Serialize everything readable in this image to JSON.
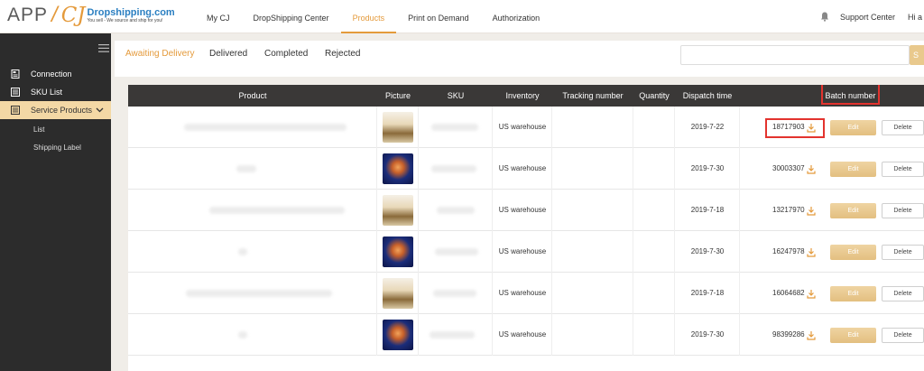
{
  "logo": {
    "app": "APP",
    "slash": "/",
    "cj": "CJ",
    "brand_name": "Dropshipping.com",
    "tagline": "You sell - We source and ship for you!"
  },
  "nav": {
    "items": [
      {
        "label": "My CJ",
        "active": false
      },
      {
        "label": "DropShipping Center",
        "active": false
      },
      {
        "label": "Products",
        "active": true
      },
      {
        "label": "Print on Demand",
        "active": false
      },
      {
        "label": "Authorization",
        "active": false
      }
    ]
  },
  "top_right": {
    "support": "Support Center",
    "greeting": "Hi a"
  },
  "sidebar": {
    "items": [
      {
        "label": "Connection",
        "icon": "document-icon"
      },
      {
        "label": "SKU List",
        "icon": "list-icon"
      },
      {
        "label": "Service Products",
        "icon": "list-icon",
        "active": true,
        "expanded": true
      }
    ],
    "subitems": [
      {
        "label": "List"
      },
      {
        "label": "Shipping Label"
      }
    ]
  },
  "tabs": [
    {
      "label": "Awaiting Delivery",
      "active": true
    },
    {
      "label": "Delivered",
      "active": false
    },
    {
      "label": "Completed",
      "active": false
    },
    {
      "label": "Rejected",
      "active": false
    }
  ],
  "search": {
    "placeholder": "",
    "button_label": "S"
  },
  "table": {
    "headers": [
      "Product",
      "Picture",
      "SKU",
      "Inventory",
      "Tracking number",
      "Quantity",
      "Dispatch time",
      "Batch number"
    ],
    "rows": [
      {
        "picture": "house",
        "inventory": "US warehouse",
        "dispatch_time": "2019-7-22",
        "batch": "18717903"
      },
      {
        "picture": "jelly",
        "inventory": "US warehouse",
        "dispatch_time": "2019-7-30",
        "batch": "30003307"
      },
      {
        "picture": "house",
        "inventory": "US warehouse",
        "dispatch_time": "2019-7-18",
        "batch": "13217970"
      },
      {
        "picture": "jelly",
        "inventory": "US warehouse",
        "dispatch_time": "2019-7-30",
        "batch": "16247978"
      },
      {
        "picture": "house",
        "inventory": "US warehouse",
        "dispatch_time": "2019-7-18",
        "batch": "16064682"
      },
      {
        "picture": "jelly",
        "inventory": "US warehouse",
        "dispatch_time": "2019-7-30",
        "batch": "98399286"
      }
    ],
    "edit_label": "Edit",
    "delete_label": "Delete"
  },
  "colors": {
    "accent": "#e49a3b",
    "sidebar_bg": "#2c2c2c",
    "header_bg": "#3a3837",
    "highlight": "#e3332e"
  }
}
